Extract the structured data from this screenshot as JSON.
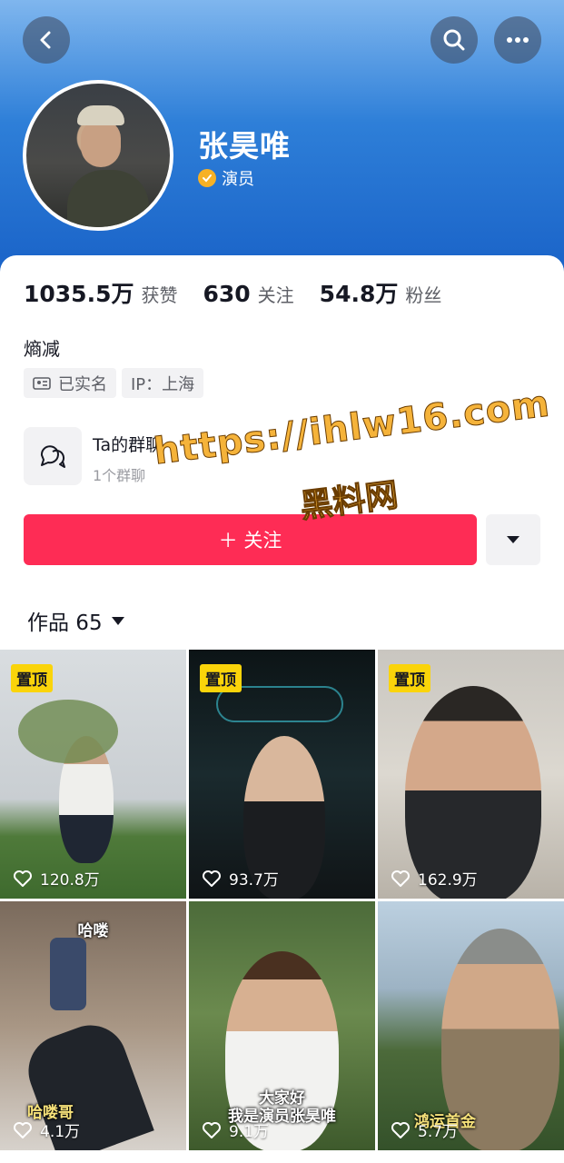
{
  "profile": {
    "name": "张昊唯",
    "verified_label": "演员",
    "bio": "熵减"
  },
  "stats": [
    {
      "value": "1035.5万",
      "label": "获赞"
    },
    {
      "value": "630",
      "label": "关注"
    },
    {
      "value": "54.8万",
      "label": "粉丝"
    }
  ],
  "tags": {
    "real_name": "已实名",
    "ip": "IP：上海"
  },
  "group": {
    "title": "Ta的群聊",
    "subtitle": "1个群聊"
  },
  "actions": {
    "follow_label": "＋ 关注"
  },
  "works": {
    "label": "作品 65"
  },
  "videos": [
    {
      "pinned": "置顶",
      "likes": "120.8万",
      "caption": ""
    },
    {
      "pinned": "置顶",
      "likes": "93.7万",
      "caption": ""
    },
    {
      "pinned": "置顶",
      "likes": "162.9万",
      "caption": ""
    },
    {
      "pinned": "",
      "likes": "4.1万",
      "caption_top": "哈喽",
      "caption": "哈喽哥"
    },
    {
      "pinned": "",
      "likes": "9.1万",
      "caption_top": "大家好",
      "caption": "我是演员张昊唯"
    },
    {
      "pinned": "",
      "likes": "5.7万",
      "caption": "鸿运首金"
    }
  ],
  "watermark": {
    "line1": "https://ihlw16.com",
    "line2": "黑料网"
  },
  "colors": {
    "accent": "#fe2c55",
    "pin": "#fad40a",
    "verify": "#f7b125"
  },
  "icons": [
    "back-icon",
    "search-icon",
    "more-icon",
    "verified-icon",
    "id-card-icon",
    "chat-group-icon",
    "plus-icon",
    "dropdown-icon",
    "heart-icon"
  ]
}
